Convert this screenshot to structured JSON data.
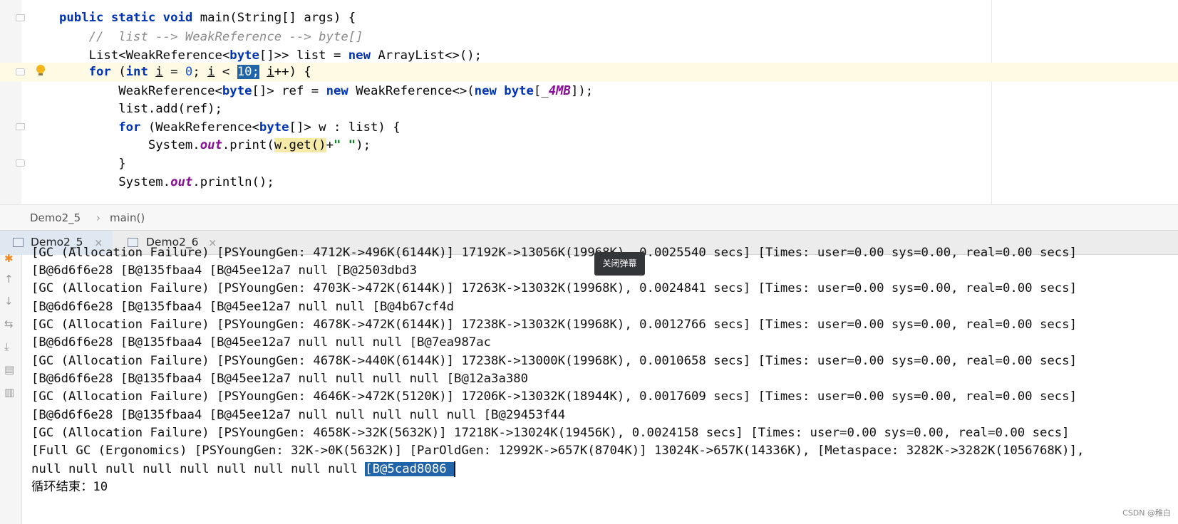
{
  "editor": {
    "lines": [
      {
        "parts": [
          {
            "t": "public static void ",
            "c": "kw"
          },
          {
            "t": "main(String[] args) {"
          }
        ]
      },
      {
        "parts": [
          {
            "t": "    "
          },
          {
            "t": "//  list --> WeakReference --> byte[]",
            "c": "cm"
          }
        ]
      },
      {
        "parts": [
          {
            "t": "    List<WeakReference<"
          },
          {
            "t": "byte",
            "c": "kw"
          },
          {
            "t": "[]>> list = "
          },
          {
            "t": "new",
            "c": "kw"
          },
          {
            "t": " ArrayList<>();"
          }
        ]
      },
      {
        "parts": [
          {
            "t": "    "
          },
          {
            "t": "for",
            "c": "kw"
          },
          {
            "t": " ("
          },
          {
            "t": "int",
            "c": "kw"
          },
          {
            "t": " "
          },
          {
            "t": "i",
            "c": "var-u"
          },
          {
            "t": " = "
          },
          {
            "t": "0",
            "c": "num"
          },
          {
            "t": "; "
          },
          {
            "t": "i",
            "c": "var-u"
          },
          {
            "t": " < "
          },
          {
            "t": "10;",
            "c": "sel-num"
          },
          {
            "t": " "
          },
          {
            "t": "i",
            "c": "var-u"
          },
          {
            "t": "++) {"
          }
        ]
      },
      {
        "parts": [
          {
            "t": "        WeakReference<"
          },
          {
            "t": "byte",
            "c": "kw"
          },
          {
            "t": "[]> ref = "
          },
          {
            "t": "new",
            "c": "kw"
          },
          {
            "t": " WeakReference<>("
          },
          {
            "t": "new",
            "c": "kw"
          },
          {
            "t": " "
          },
          {
            "t": "byte",
            "c": "kw"
          },
          {
            "t": "[_"
          },
          {
            "t": "4MB",
            "c": "fld"
          },
          {
            "t": "]);"
          }
        ]
      },
      {
        "parts": [
          {
            "t": "        list.add(ref);"
          }
        ]
      },
      {
        "parts": [
          {
            "t": "        "
          },
          {
            "t": "for",
            "c": "kw"
          },
          {
            "t": " (WeakReference<"
          },
          {
            "t": "byte",
            "c": "kw"
          },
          {
            "t": "[]> w : list) {"
          }
        ]
      },
      {
        "parts": [
          {
            "t": "            System."
          },
          {
            "t": "out",
            "c": "fld"
          },
          {
            "t": ".print("
          },
          {
            "t": "w.get()",
            "c": "hl"
          },
          {
            "t": "+"
          },
          {
            "t": "\" \"",
            "c": "str"
          },
          {
            "t": ");"
          }
        ]
      },
      {
        "parts": [
          {
            "t": "        }"
          }
        ]
      },
      {
        "parts": [
          {
            "t": "        System."
          },
          {
            "t": "out",
            "c": "fld"
          },
          {
            "t": ".println();"
          }
        ]
      }
    ]
  },
  "breadcrumb": {
    "class_name": "Demo2_5",
    "separator": "›",
    "method": "main()"
  },
  "run_tabs": [
    {
      "label": "Demo2_5",
      "close": "×"
    },
    {
      "label": "Demo2_6",
      "close": "×"
    }
  ],
  "console": {
    "lines": [
      "[GC (Allocation Failure) [PSYoungGen: 4712K->496K(6144K)] 17192K->13056K(19968K), 0.0025540 secs] [Times: user=0.00 sys=0.00, real=0.00 secs]",
      "[B@6d6f6e28 [B@135fbaa4 [B@45ee12a7 null [B@2503dbd3",
      "[GC (Allocation Failure) [PSYoungGen: 4703K->472K(6144K)] 17263K->13032K(19968K), 0.0024841 secs] [Times: user=0.00 sys=0.00, real=0.00 secs]",
      "[B@6d6f6e28 [B@135fbaa4 [B@45ee12a7 null null [B@4b67cf4d",
      "[GC (Allocation Failure) [PSYoungGen: 4678K->472K(6144K)] 17238K->13032K(19968K), 0.0012766 secs] [Times: user=0.00 sys=0.00, real=0.00 secs]",
      "[B@6d6f6e28 [B@135fbaa4 [B@45ee12a7 null null null [B@7ea987ac",
      "[GC (Allocation Failure) [PSYoungGen: 4678K->440K(6144K)] 17238K->13000K(19968K), 0.0010658 secs] [Times: user=0.00 sys=0.00, real=0.00 secs]",
      "[B@6d6f6e28 [B@135fbaa4 [B@45ee12a7 null null null null [B@12a3a380",
      "[GC (Allocation Failure) [PSYoungGen: 4646K->472K(5120K)] 17206K->13032K(18944K), 0.0017609 secs] [Times: user=0.00 sys=0.00, real=0.00 secs]",
      "[B@6d6f6e28 [B@135fbaa4 [B@45ee12a7 null null null null null [B@29453f44",
      "[GC (Allocation Failure) [PSYoungGen: 4658K->32K(5632K)] 17218K->13024K(19456K), 0.0024158 secs] [Times: user=0.00 sys=0.00, real=0.00 secs]",
      "[Full GC (Ergonomics) [PSYoungGen: 32K->0K(5632K)] [ParOldGen: 12992K->657K(8704K)] 13024K->657K(14336K), [Metaspace: 3282K->3282K(1056768K)],"
    ],
    "last_line_prefix": "null null null null null null null null null ",
    "last_line_selected": "[B@5cad8086 ",
    "final_line": "循环结束：10"
  },
  "tooltip": "关闭弹幕",
  "watermark": "CSDN @稚白",
  "toolbar_icons": [
    "run-icon",
    "up-arrow-icon",
    "down-arrow-icon",
    "soft-wrap-icon",
    "scroll-to-end-icon",
    "print-icon",
    "trash-icon"
  ]
}
